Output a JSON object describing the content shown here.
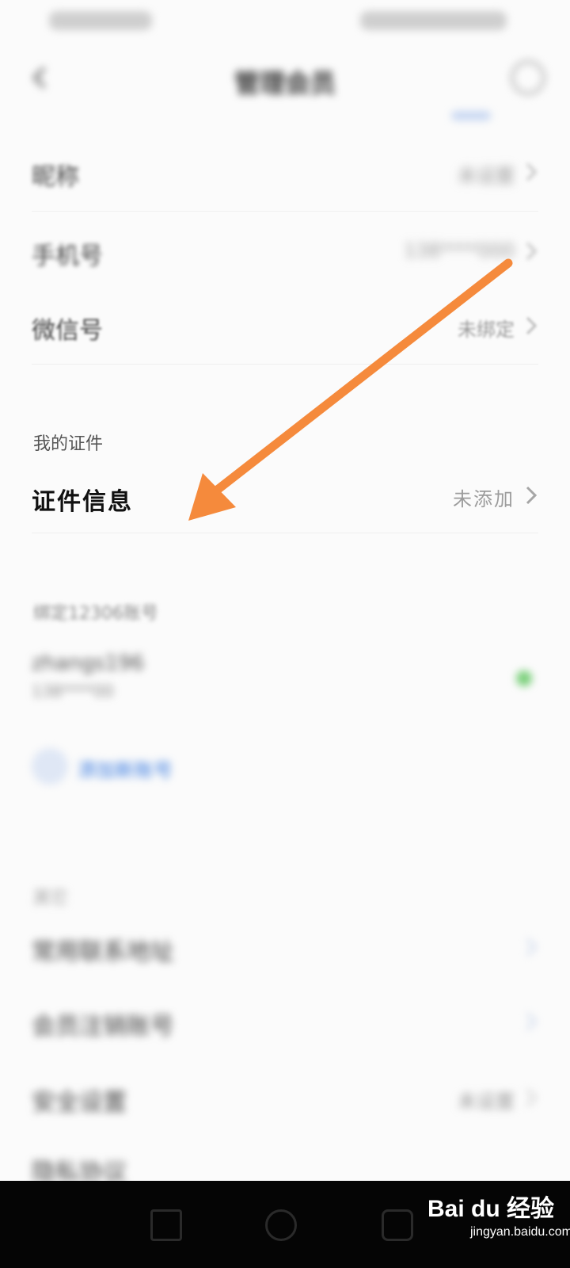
{
  "header": {
    "title": "管理会员"
  },
  "rows": {
    "nickname": {
      "label": "昵称",
      "value": "未设置"
    },
    "phone": {
      "label": "手机号",
      "value": "138****000"
    },
    "wechat": {
      "label": "微信号",
      "value": "未绑定"
    }
  },
  "certs": {
    "section_title": "我的证件",
    "info_label": "证件信息",
    "info_value": "未添加"
  },
  "binding": {
    "section_title": "绑定12306账号",
    "account_name": "zhangs196",
    "account_sub": "138****00",
    "add_label": "添加新账号"
  },
  "other": {
    "section_title": "其它",
    "items": [
      {
        "label": "常用联系地址",
        "value": ""
      },
      {
        "label": "会员注销账号",
        "value": ""
      },
      {
        "label": "安全设置",
        "value": "未设置"
      },
      {
        "label": "隐私协议",
        "value": ""
      }
    ]
  },
  "watermark": {
    "brand": "Bai du 经验",
    "url": "jingyan.baidu.com"
  },
  "colors": {
    "arrow": "#f58a3c",
    "link": "#3a7be0"
  }
}
